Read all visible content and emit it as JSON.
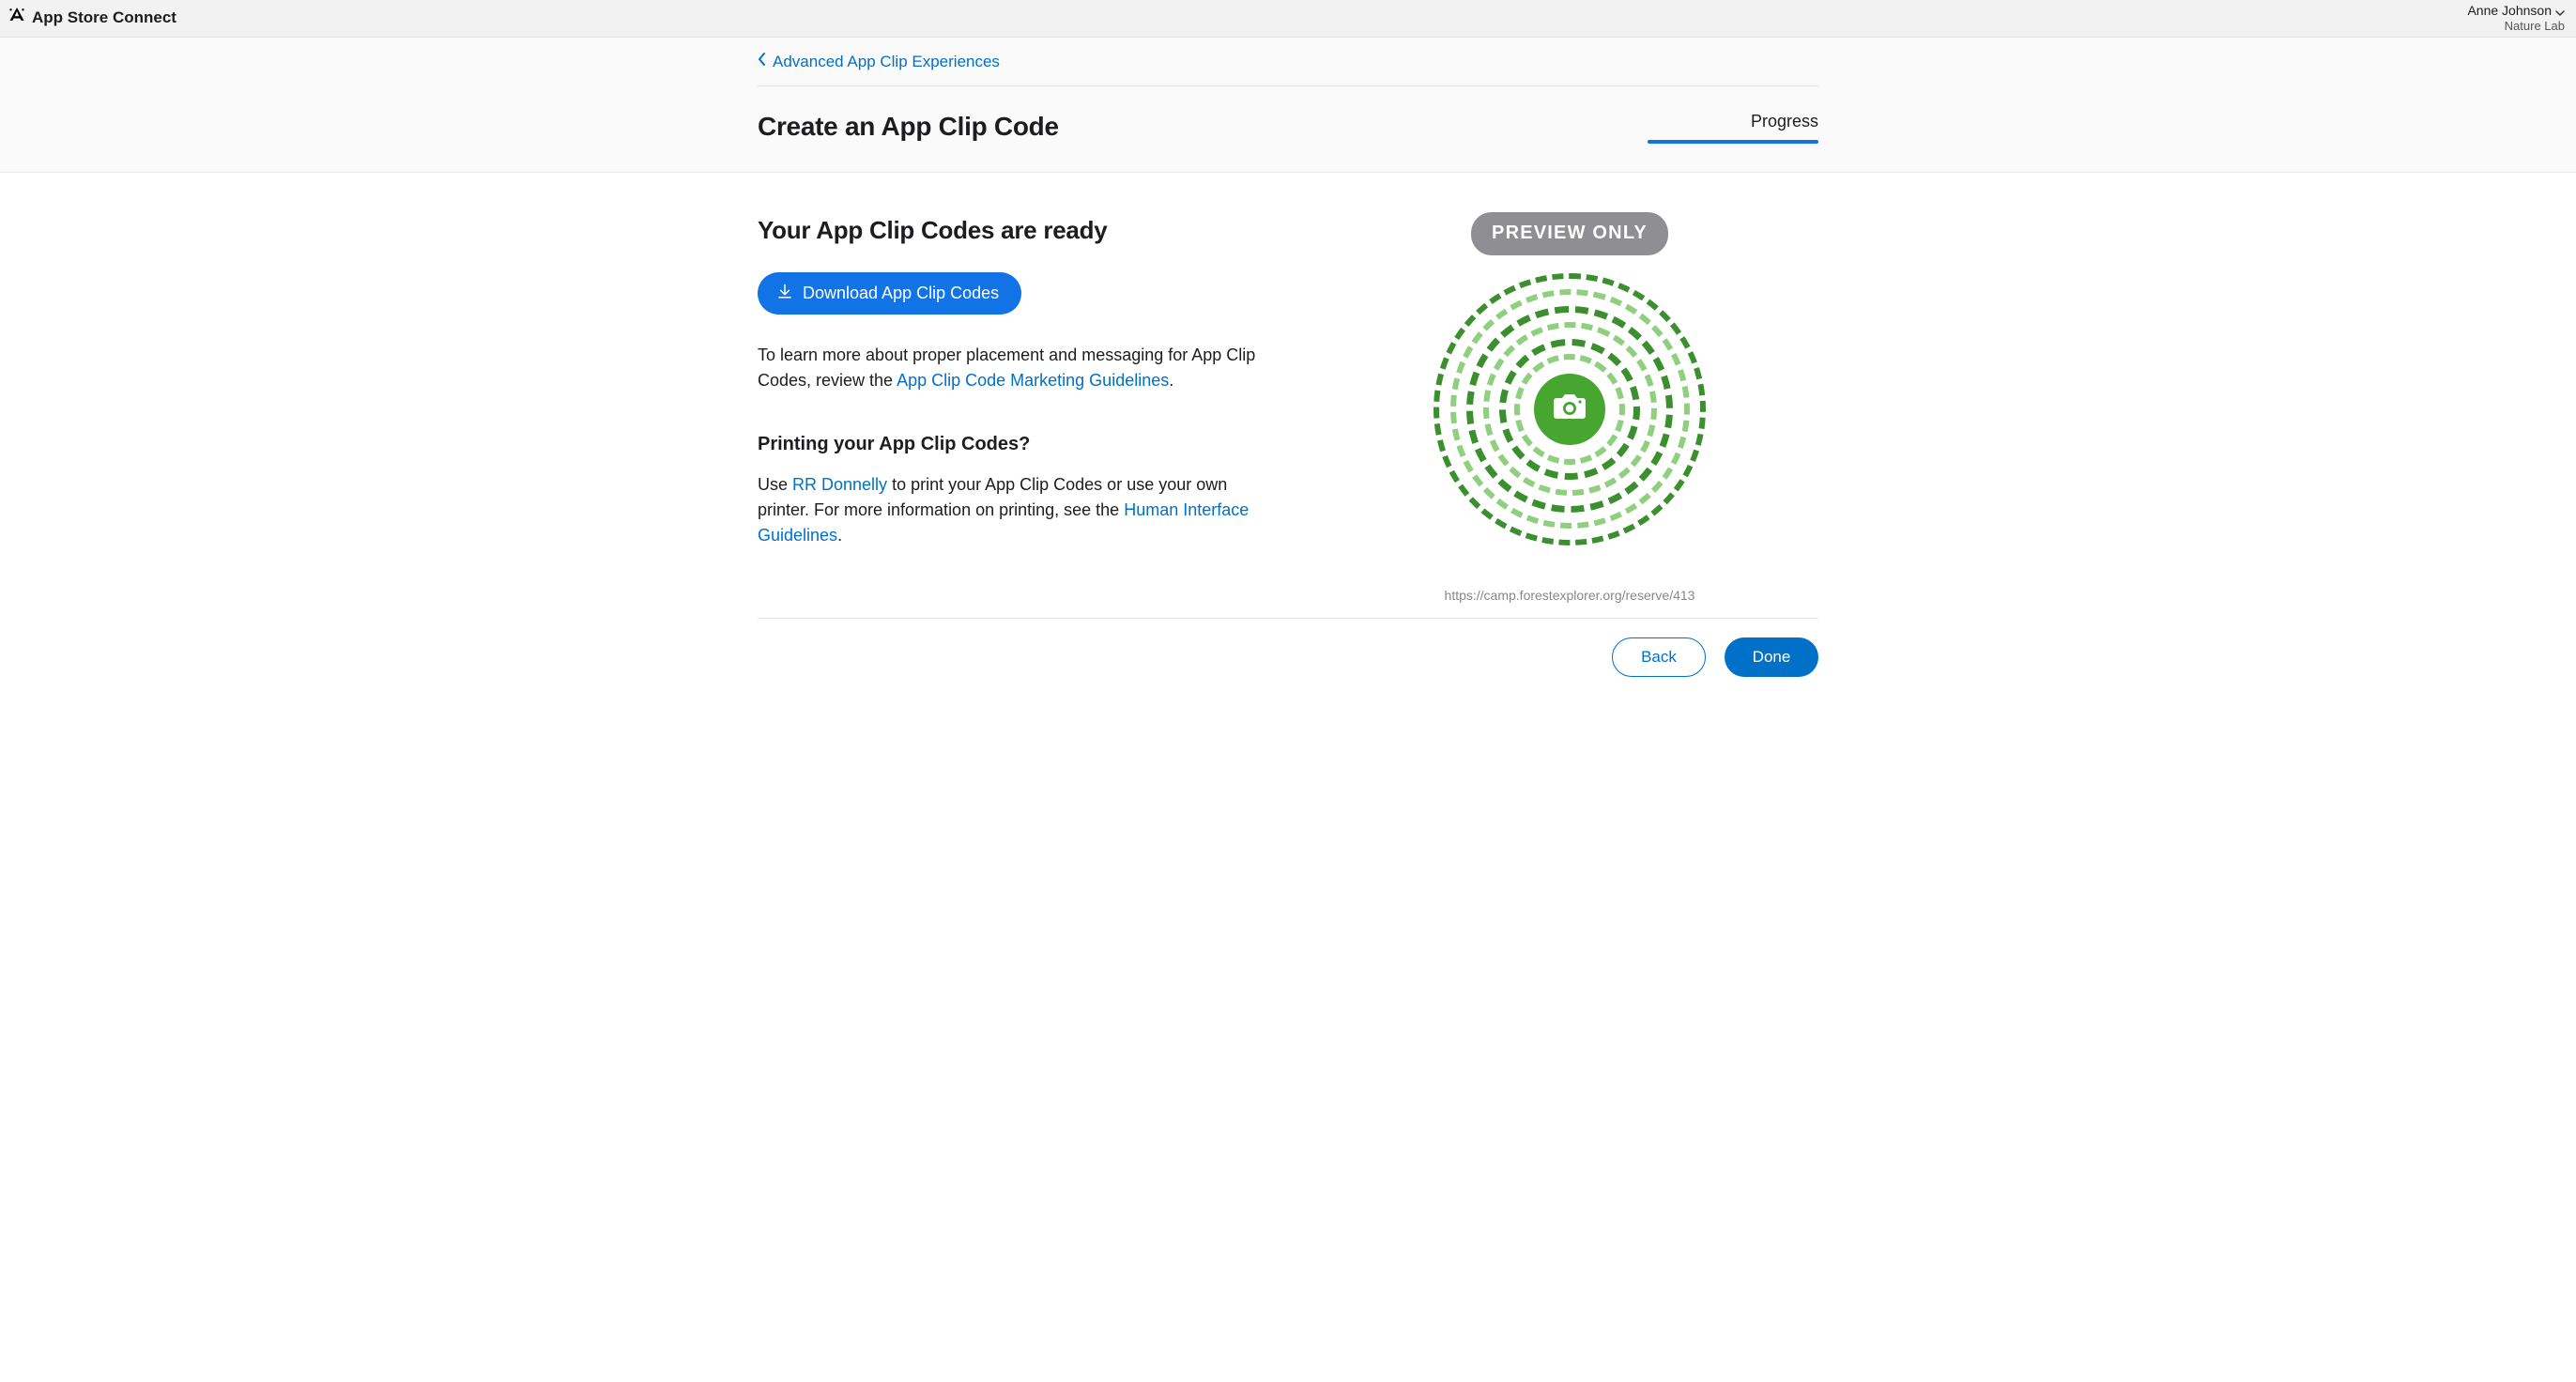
{
  "header": {
    "brand": "App Store Connect",
    "user_name": "Anne Johnson",
    "user_org": "Nature Lab"
  },
  "breadcrumb": {
    "back_label": "Advanced App Clip Experiences"
  },
  "title_row": {
    "page_title": "Create an App Clip Code",
    "progress_label": "Progress"
  },
  "main": {
    "ready_title": "Your App Clip Codes are ready",
    "download_label": "Download App Clip Codes",
    "learn_more_pre": "To learn more about proper placement and messaging for App Clip Codes, review the ",
    "learn_more_link": "App Clip Code Marketing Guidelines",
    "learn_more_post": ".",
    "printing_heading": "Printing your App Clip Codes?",
    "printing_pre": "Use ",
    "printing_link1": "RR Donnelly",
    "printing_mid": " to print your App Clip Codes or use your own printer. For more information on printing, see the ",
    "printing_link2": "Human Interface Guidelines",
    "printing_post": "."
  },
  "preview": {
    "badge": "PREVIEW ONLY",
    "url": "https://camp.forestexplorer.org/reserve/413"
  },
  "footer": {
    "back": "Back",
    "done": "Done"
  }
}
